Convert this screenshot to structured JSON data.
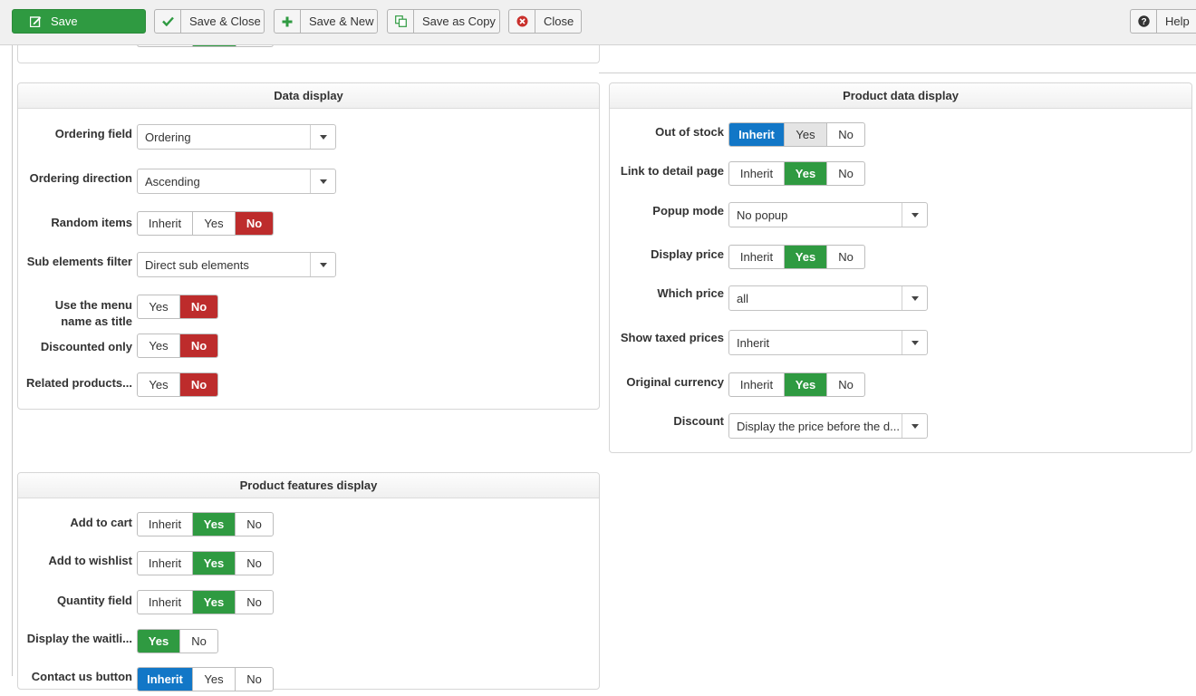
{
  "toolbar": {
    "save": "Save",
    "save_close": "Save & Close",
    "save_new": "Save & New",
    "save_copy": "Save as Copy",
    "close": "Close",
    "help": "Help"
  },
  "data_display": {
    "title": "Data display",
    "ordering_field": {
      "label": "Ordering field",
      "value": "Ordering"
    },
    "ordering_direction": {
      "label": "Ordering direction",
      "value": "Ascending"
    },
    "random_items": {
      "label": "Random items",
      "options": [
        "Inherit",
        "Yes",
        "No"
      ],
      "selected": "No"
    },
    "sub_elements_filter": {
      "label": "Sub elements filter",
      "value": "Direct sub elements"
    },
    "menu_name_title": {
      "label": "Use the menu name as title",
      "options": [
        "Yes",
        "No"
      ],
      "selected": "No"
    },
    "discounted_only": {
      "label": "Discounted only",
      "options": [
        "Yes",
        "No"
      ],
      "selected": "No"
    },
    "related_products": {
      "label": "Related products...",
      "options": [
        "Yes",
        "No"
      ],
      "selected": "No"
    }
  },
  "product_data_display": {
    "title": "Product data display",
    "out_of_stock": {
      "label": "Out of stock",
      "options": [
        "Inherit",
        "Yes",
        "No"
      ],
      "selected": "Inherit"
    },
    "link_detail": {
      "label": "Link to detail page",
      "options": [
        "Inherit",
        "Yes",
        "No"
      ],
      "selected": "Yes"
    },
    "popup_mode": {
      "label": "Popup mode",
      "value": "No popup"
    },
    "display_price": {
      "label": "Display price",
      "options": [
        "Inherit",
        "Yes",
        "No"
      ],
      "selected": "Yes"
    },
    "which_price": {
      "label": "Which price",
      "value": "all"
    },
    "show_taxed": {
      "label": "Show taxed prices",
      "value": "Inherit"
    },
    "original_currency": {
      "label": "Original currency",
      "options": [
        "Inherit",
        "Yes",
        "No"
      ],
      "selected": "Yes"
    },
    "discount": {
      "label": "Discount",
      "value": "Display the price before the d..."
    }
  },
  "product_features_display": {
    "title": "Product features display",
    "add_to_cart": {
      "label": "Add to cart",
      "options": [
        "Inherit",
        "Yes",
        "No"
      ],
      "selected": "Yes"
    },
    "add_to_wishlist": {
      "label": "Add to wishlist",
      "options": [
        "Inherit",
        "Yes",
        "No"
      ],
      "selected": "Yes"
    },
    "quantity_field": {
      "label": "Quantity field",
      "options": [
        "Inherit",
        "Yes",
        "No"
      ],
      "selected": "Yes"
    },
    "display_waitlist": {
      "label": "Display the waitli...",
      "options": [
        "Yes",
        "No"
      ],
      "selected": "Yes"
    },
    "contact_us": {
      "label": "Contact us button",
      "options": [
        "Inherit",
        "Yes",
        "No"
      ],
      "selected": "Inherit"
    }
  },
  "colors": {
    "green": "#2f9a41",
    "red": "#bd2c2c",
    "blue": "#1277c7"
  }
}
